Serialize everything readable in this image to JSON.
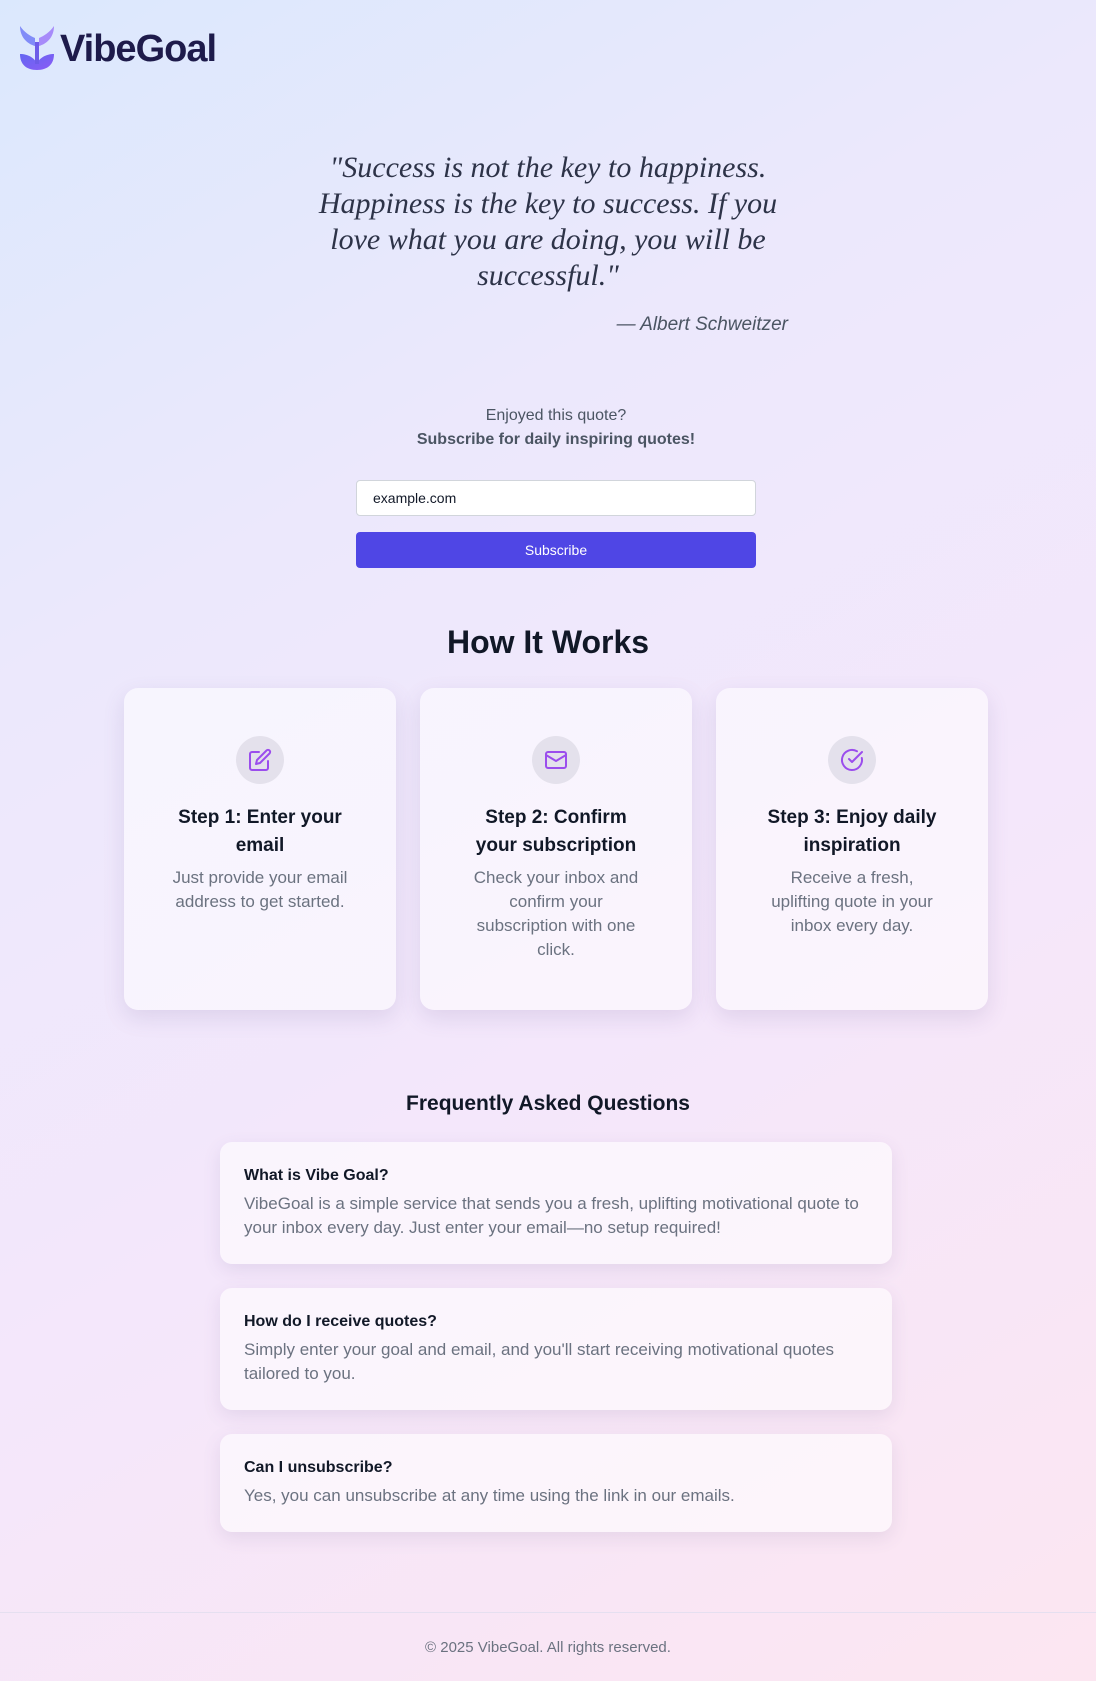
{
  "brand": {
    "name": "VibeGoal"
  },
  "quote": {
    "text": "\"Success is not the key to happiness. Happiness is the key to success. If you love what you are doing, you will be successful.\"",
    "author": "— Albert Schweitzer"
  },
  "subscribe": {
    "prompt": "Enjoyed this quote?",
    "cta": "Subscribe for daily inspiring quotes!",
    "email_value": "example.com",
    "button_label": "Subscribe"
  },
  "how_it_works": {
    "title": "How It Works",
    "steps": [
      {
        "icon": "edit-icon",
        "title": "Step 1: Enter your email",
        "description": "Just provide your email address to get started."
      },
      {
        "icon": "mail-icon",
        "title": "Step 2: Confirm your subscription",
        "description": "Check your inbox and confirm your subscription with one click."
      },
      {
        "icon": "check-circle-icon",
        "title": "Step 3: Enjoy daily inspiration",
        "description": "Receive a fresh, uplifting quote in your inbox every day."
      }
    ]
  },
  "faq": {
    "title": "Frequently Asked Questions",
    "items": [
      {
        "question": "What is Vibe Goal?",
        "answer": "VibeGoal is a simple service that sends you a fresh, uplifting motivational quote to your inbox every day. Just enter your email—no setup required!"
      },
      {
        "question": "How do I receive quotes?",
        "answer": "Simply enter your goal and email, and you'll start receiving motivational quotes tailored to you."
      },
      {
        "question": "Can I unsubscribe?",
        "answer": "Yes, you can unsubscribe at any time using the link in our emails."
      }
    ]
  },
  "footer": {
    "copyright": "© 2025 VibeGoal. All rights reserved."
  },
  "colors": {
    "accent": "#4f46e5",
    "icon": "#9b4ded",
    "logo_text": "#1e1b4b"
  }
}
